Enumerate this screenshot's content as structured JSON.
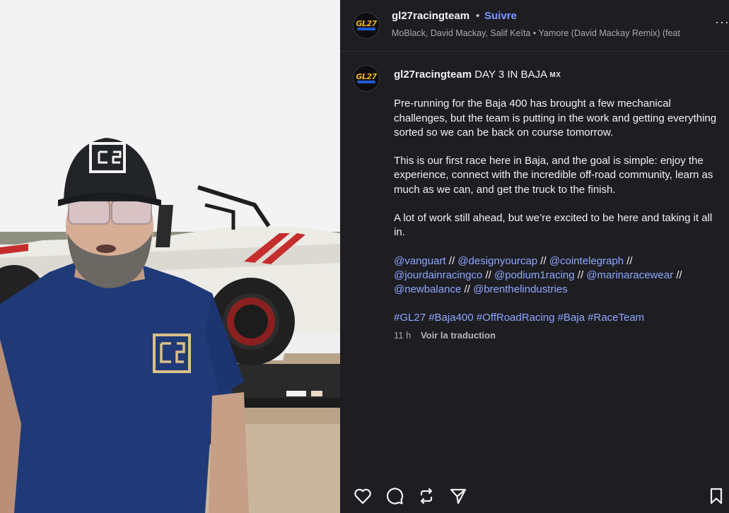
{
  "header": {
    "username": "gl27racingteam",
    "separator": "•",
    "follow_label": "Suivre",
    "audio": "MoBlack, David Mackay, Salif Keïta • Yamore (David Mackay Remix) (feat",
    "more_icon": "more-options-icon"
  },
  "avatar": {
    "logo_text": "GL27"
  },
  "post": {
    "username": "gl27racingteam",
    "title": "DAY 3 IN BAJA",
    "flag": "MX",
    "paragraphs": [
      "Pre-running for the Baja 400 has brought a few mechanical challenges, but the team is putting in the work and getting everything sorted so we can be back on course tomorrow.",
      "This is our first race here in Baja, and the goal is simple: enjoy the experience, connect with the incredible off-road community, learn as much as we can, and get the truck to the finish.",
      "A lot of work still ahead, but we’re excited to be here and taking it all in."
    ],
    "mentions": [
      "@vanguart",
      "@designyourcap",
      "@cointelegraph",
      "@jourdainracingco",
      "@podium1racing",
      "@marinaracewear",
      "@newbalance",
      "@brenthelindustries"
    ],
    "mention_separator": "//",
    "hashtags": [
      "#GL27",
      "#Baja400",
      "#OffRoadRacing",
      "#Baja",
      "#RaceTeam"
    ],
    "time": "11 h",
    "translate_label": "Voir la traduction"
  },
  "actions": [
    "heart-icon",
    "comment-icon",
    "repost-icon",
    "share-icon",
    "bookmark-icon"
  ],
  "colors": {
    "background": "#1d1d22",
    "link": "#8fa8ff",
    "follow": "#7f97ff",
    "muted": "#a8a8ad",
    "logo_gold": "#f2b418"
  }
}
